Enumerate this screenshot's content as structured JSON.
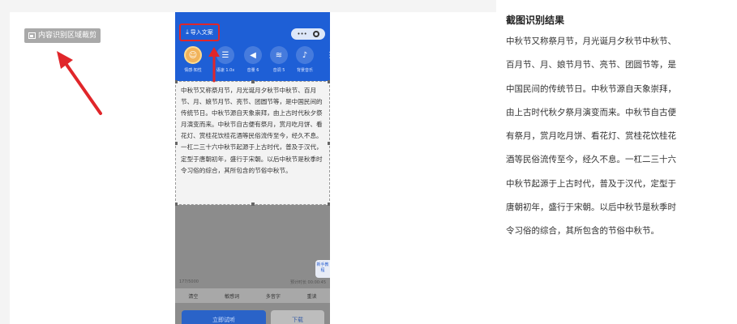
{
  "overlay": {
    "crop_label": "内容识别区域裁剪"
  },
  "phone": {
    "status_left": "",
    "status_right": "",
    "import_button": "导入文案",
    "pill_dots": "•••",
    "tools": [
      {
        "icon": "avatar-icon",
        "glyph": "☺",
        "label": "情感·知性"
      },
      {
        "icon": "sliders-icon",
        "glyph": "☰",
        "label": "语速 1.0x"
      },
      {
        "icon": "speaker-icon",
        "glyph": "◀",
        "label": "音量 6"
      },
      {
        "icon": "waveform-icon",
        "glyph": "≋",
        "label": "音调 5"
      },
      {
        "icon": "music-note-icon",
        "glyph": "♪",
        "label": "背景音乐"
      }
    ],
    "more_glyph": "⋮",
    "selection_text": "中秋节又称祭月节，月光诞月夕秋节中秋节、百月节、月、娘节月节、亮节、团圆节等，是中国民间的传统节日。中秋节源自天象崇拜，由上古时代秋夕祭月演变而来。中秋节自古便有祭月，赏月吃月饼、看花灯、赏桂花饮桂花酒等民俗流传至今，经久不息。一杠二三十六中秋节起源于上古时代，普及于汉代，定型于唐朝初年，盛行于宋朝。以后中秋节是秋季时令习俗的综合，其所包含的节俗中秋节。",
    "counter": "177/5000",
    "time_label": "预计时长 00:00:45",
    "guide_label": "新手教程",
    "actions": [
      "清空",
      "敏感词",
      "多音字",
      "重读"
    ],
    "try_button": "立即试听",
    "download_button": "下载"
  },
  "result": {
    "title": "截图识别结果",
    "text": "中秋节又称祭月节，月光诞月夕秋节中秋节、百月节、月、娘节月节、亮节、团圆节等，是中国民间的传统节日。中秋节源自天象崇拜，由上古时代秋夕祭月演变而来。中秋节自古便有祭月，赏月吃月饼、看花灯、赏桂花饮桂花酒等民俗流传至今，经久不息。一杠二三十六中秋节起源于上古时代，普及于汉代，定型于唐朝初年，盛行于宋朝。以后中秋节是秋季时令习俗的综合，其所包含的节俗中秋节。"
  },
  "colors": {
    "accent_blue": "#1e5fd6",
    "arrow_red": "#e0262a",
    "dim_overlay": "#8c8c8c"
  }
}
